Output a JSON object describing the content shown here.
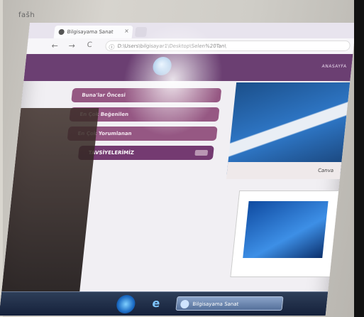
{
  "monitor": {
    "brand": "fašh"
  },
  "browser": {
    "tab_title": "Bilgisayama Sanat",
    "tab_close": "×",
    "address": "D:\\Users\\bilgisayar1\\Desktop\\Selen%20Tan\\",
    "nav": {
      "back": "←",
      "forward": "→",
      "reload": "C",
      "info": "ⓘ"
    }
  },
  "page": {
    "header_text": "ANASAYFA",
    "menu": [
      {
        "label": "Buna'lar Öncesi",
        "active": false
      },
      {
        "label": "En Çok Beğenilen",
        "active": false
      },
      {
        "label": "En Çok Yorumlanan",
        "active": false
      },
      {
        "label": "TAVSİYELERİMİZ",
        "active": true
      }
    ],
    "banner_caption": "Canva"
  },
  "taskbar": {
    "ie_icon": "e",
    "task_label": "Bilgisayama Sanat"
  },
  "colors": {
    "accent_purple": "#6b3f72",
    "menu_purple": "#8e4b7a",
    "taskbar": "#14203a"
  }
}
